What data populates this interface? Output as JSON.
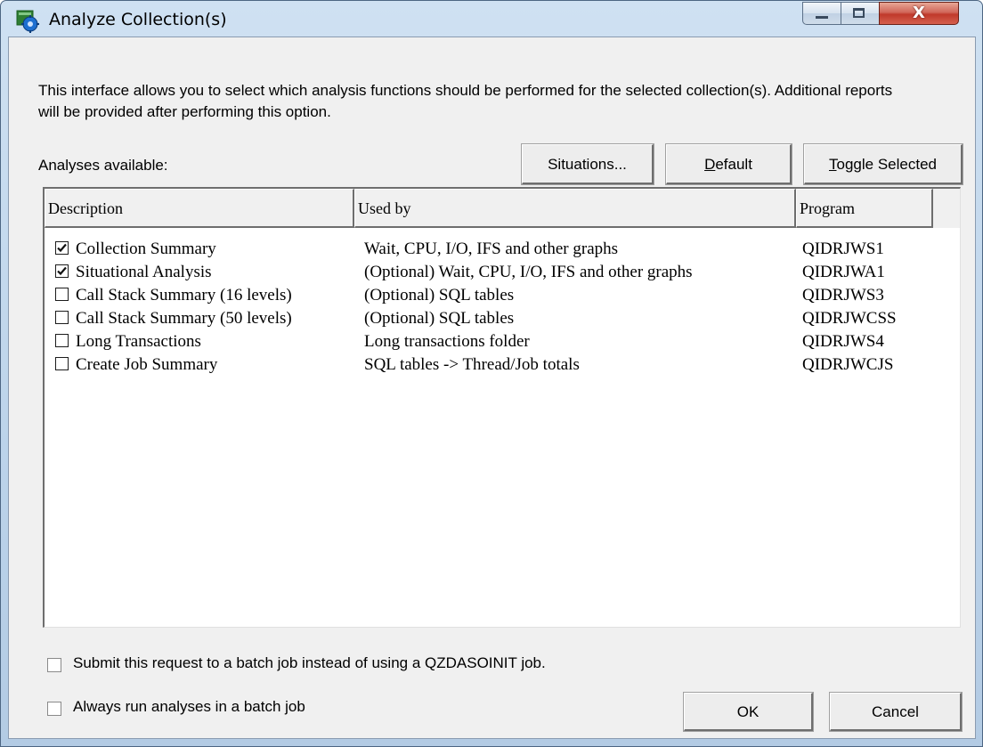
{
  "window": {
    "title": "Analyze Collection(s)",
    "icon": "gear-app-icon",
    "close_glyph": "X"
  },
  "intro_text": "This interface allows you to select which analysis functions should be performed for the selected collection(s).  Additional reports will be provided after performing this option.",
  "analyses_label": "Analyses available:",
  "buttons": {
    "situations": "Situations...",
    "default_mnemonic": "D",
    "default_rest": "efault",
    "toggle_mnemonic": "T",
    "toggle_rest": "oggle Selected",
    "ok": "OK",
    "cancel": "Cancel"
  },
  "table": {
    "columns": [
      "Description",
      "Used by",
      "Program"
    ],
    "rows": [
      {
        "checked": true,
        "description": "Collection Summary",
        "used_by": "Wait, CPU, I/O, IFS and other graphs",
        "program": "QIDRJWS1"
      },
      {
        "checked": true,
        "description": "Situational Analysis",
        "used_by": "(Optional) Wait, CPU, I/O, IFS and other graphs",
        "program": "QIDRJWA1"
      },
      {
        "checked": false,
        "description": "Call Stack Summary (16 levels)",
        "used_by": "(Optional) SQL tables",
        "program": "QIDRJWS3"
      },
      {
        "checked": false,
        "description": "Call Stack Summary (50 levels)",
        "used_by": "(Optional) SQL tables",
        "program": "QIDRJWCSS"
      },
      {
        "checked": false,
        "description": "Long Transactions",
        "used_by": "Long transactions folder",
        "program": "QIDRJWS4"
      },
      {
        "checked": false,
        "description": "Create Job Summary",
        "used_by": "SQL tables -> Thread/Job totals",
        "program": "QIDRJWCJS"
      }
    ]
  },
  "options": {
    "submit_batch_label": "Submit this request to a batch job instead of using a QZDASOINIT job.",
    "submit_batch_checked": false,
    "always_batch_label": "Always run analyses in a batch job",
    "always_batch_checked": false
  },
  "colors": {
    "titlebar": "#bcd3ea",
    "close_button": "#c0392b",
    "dialog_bg": "#f0f0f0",
    "list_bg": "#ffffff"
  }
}
